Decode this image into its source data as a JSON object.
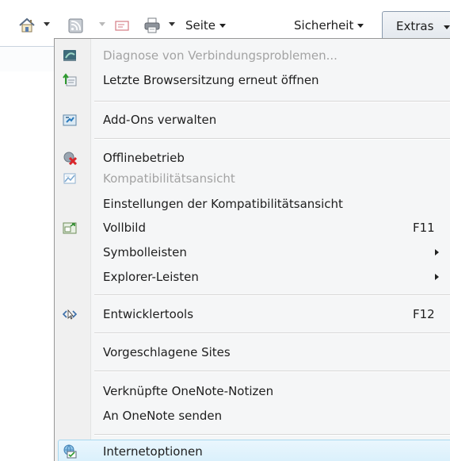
{
  "toolbar": {
    "home_icon": "home-icon",
    "feeds_icon": "feeds-icon",
    "mail_icon": "mail-icon",
    "print_icon": "print-icon",
    "page_label": "Seite",
    "safety_label": "Sicherheit",
    "tools_label": "Extras"
  },
  "menu": {
    "items": [
      {
        "label": "Diagnose von Verbindungsproblemen...",
        "icon": "network-diagnose-icon",
        "disabled": true
      },
      {
        "label": "Letzte Browsersitzung erneut öffnen",
        "icon": "reopen-session-icon"
      },
      {
        "label": "Add-Ons verwalten",
        "icon": "addons-icon"
      },
      {
        "label": "Offlinebetrieb",
        "icon": "offline-icon"
      },
      {
        "label": "Kompatibilitätsansicht",
        "icon": "compatibility-view-icon",
        "disabled": true
      },
      {
        "label": "Einstellungen der Kompatibilitätsansicht"
      },
      {
        "label": "Vollbild",
        "icon": "fullscreen-icon",
        "shortcut": "F11"
      },
      {
        "label": "Symbolleisten",
        "submenu": true
      },
      {
        "label": "Explorer-Leisten",
        "submenu": true
      },
      {
        "label": "Entwicklertools",
        "icon": "developer-tools-icon",
        "shortcut": "F12"
      },
      {
        "label": "Vorgeschlagene Sites"
      },
      {
        "label": "Verknüpfte OneNote-Notizen"
      },
      {
        "label": "An OneNote senden"
      },
      {
        "label": "Internetoptionen",
        "icon": "internet-options-icon",
        "highlighted": true
      }
    ]
  },
  "colors": {
    "highlight_border": "#a8d8f0",
    "highlight_fill": "#d9f0fc",
    "disabled_text": "#a3a3a3",
    "menu_background": "#f5f6f7"
  }
}
